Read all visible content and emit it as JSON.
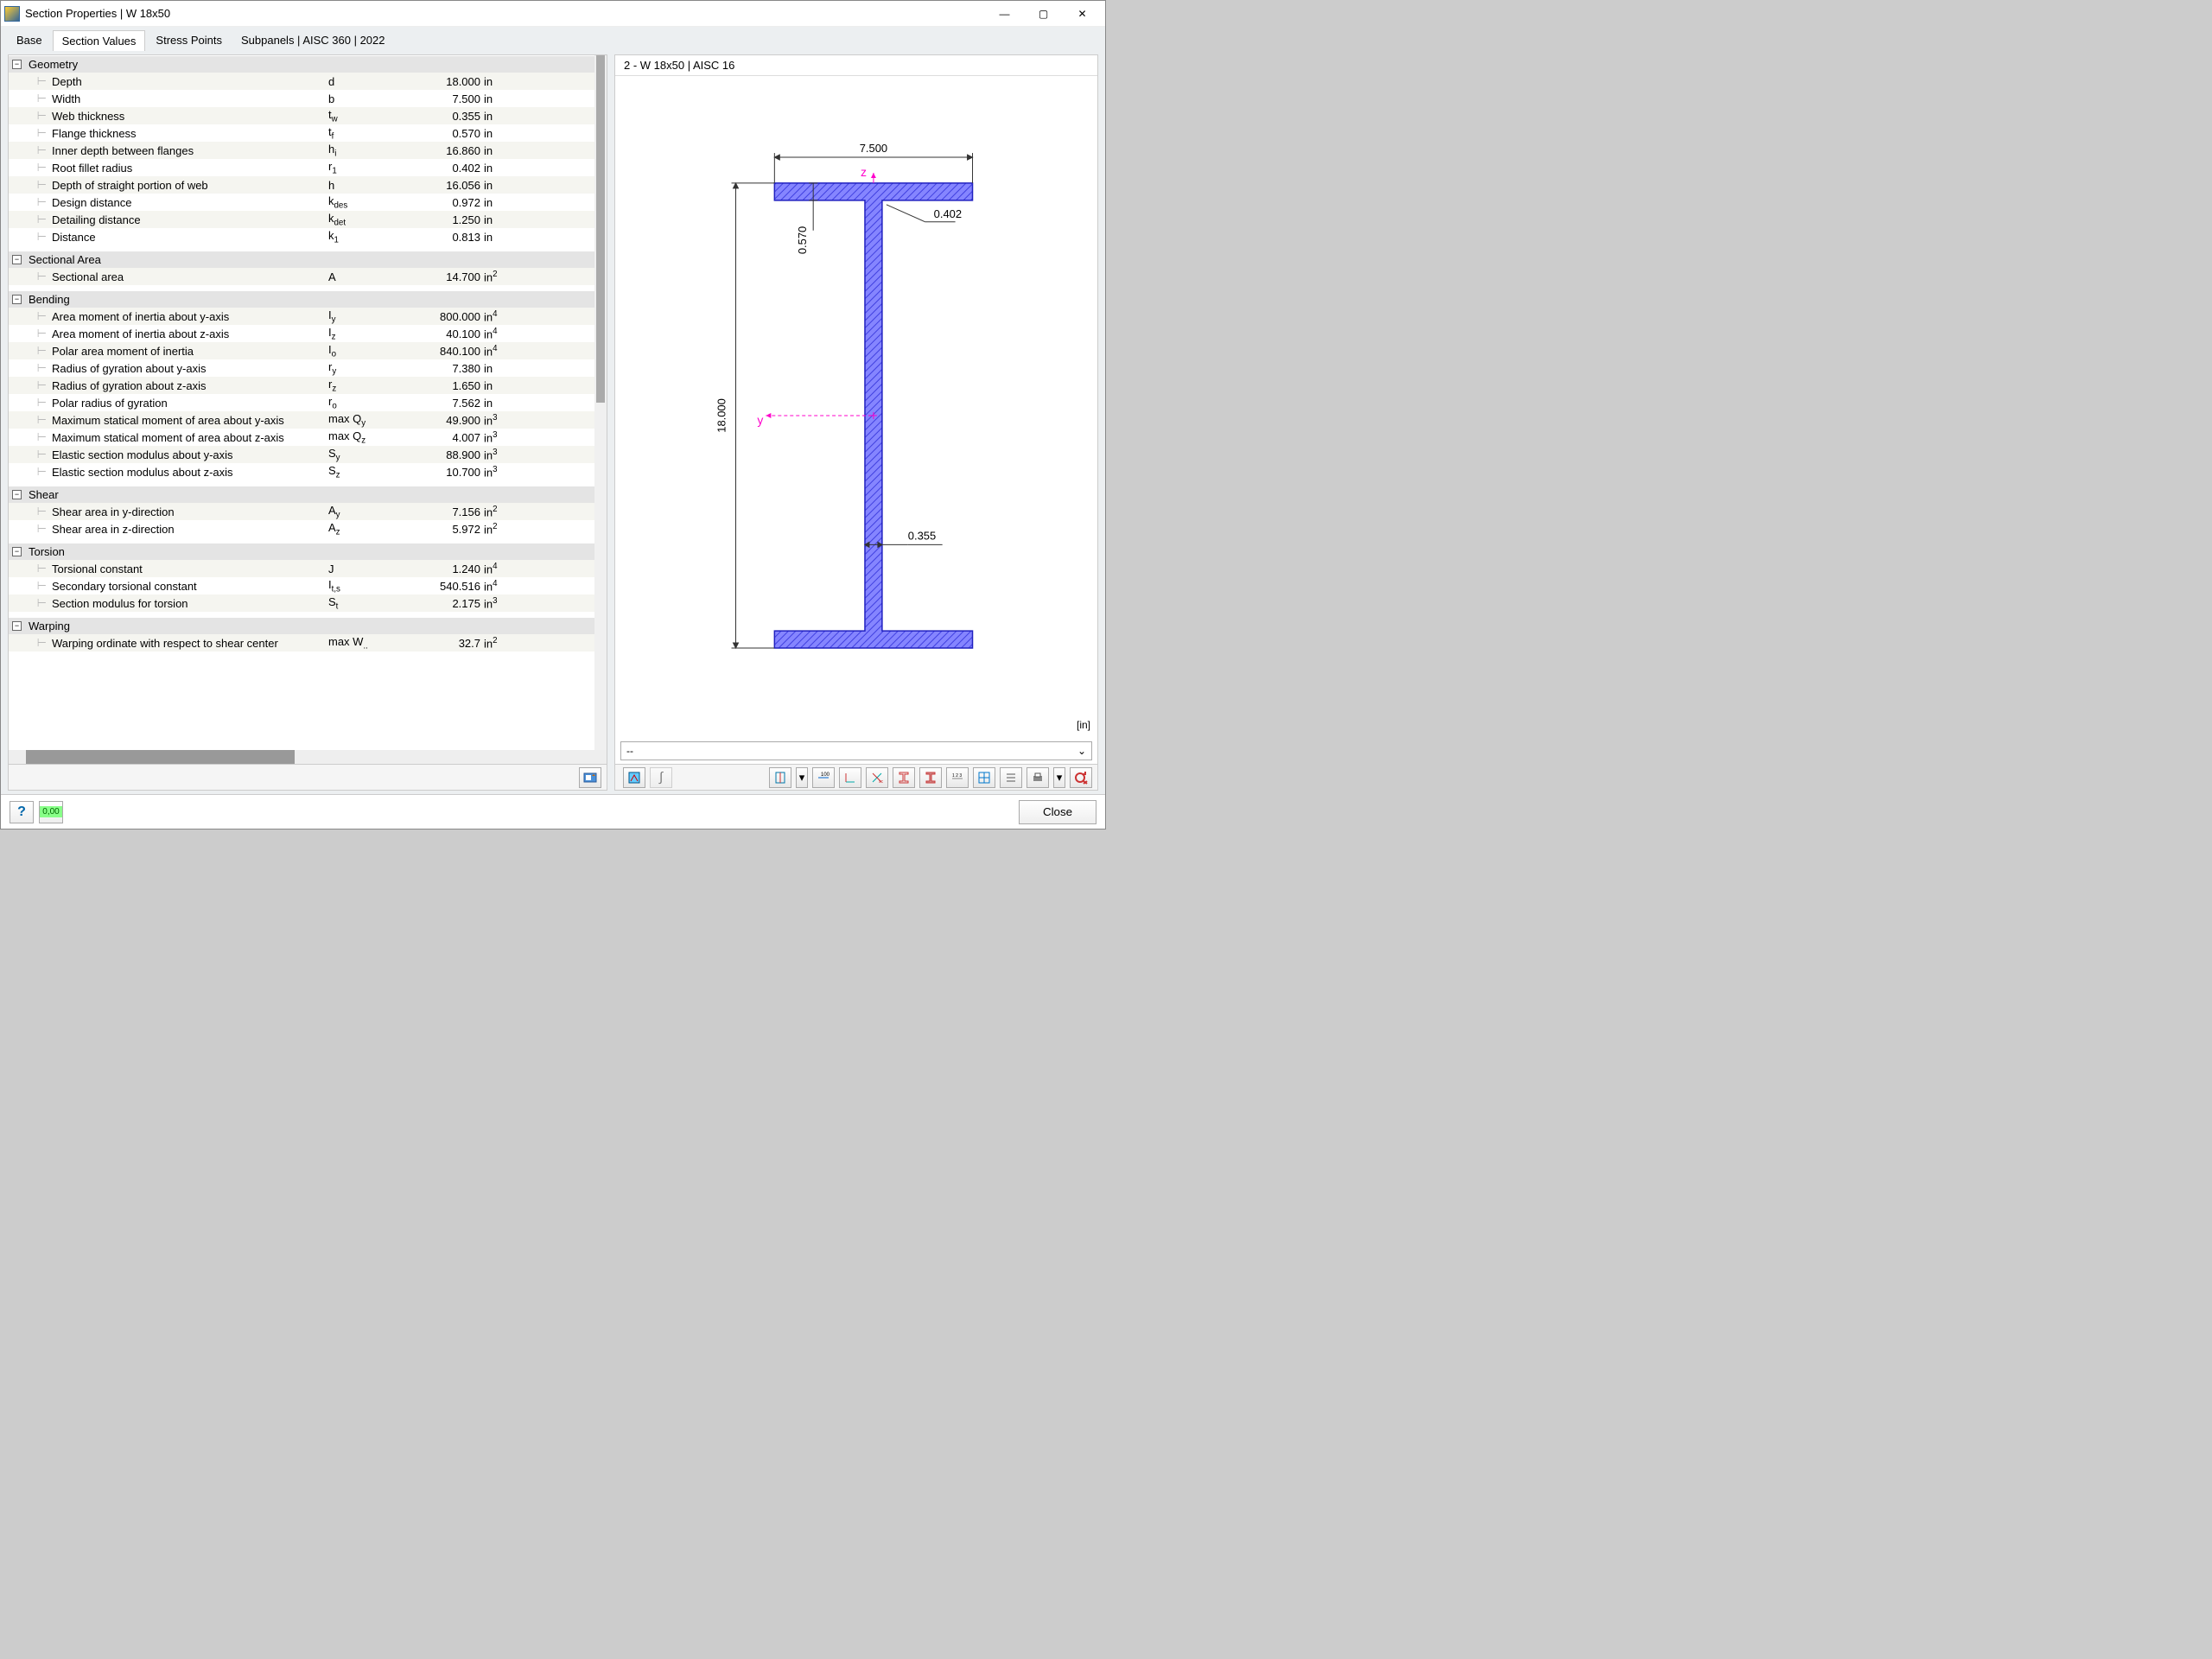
{
  "window_title": "Section Properties | W 18x50",
  "tabs": [
    "Base",
    "Section Values",
    "Stress Points",
    "Subpanels | AISC 360 | 2022"
  ],
  "active_tab": 1,
  "preview_title": "2 - W 18x50 | AISC 16",
  "preview_unit": "[in]",
  "dropdown_value": "--",
  "close_label": "Close",
  "sections": [
    {
      "title": "Geometry",
      "rows": [
        {
          "name": "Depth",
          "sym": "d",
          "val": "18.000",
          "unit": "in"
        },
        {
          "name": "Width",
          "sym": "b",
          "val": "7.500",
          "unit": "in"
        },
        {
          "name": "Web thickness",
          "sym": "t<sub>w</sub>",
          "val": "0.355",
          "unit": "in"
        },
        {
          "name": "Flange thickness",
          "sym": "t<sub>f</sub>",
          "val": "0.570",
          "unit": "in"
        },
        {
          "name": "Inner depth between flanges",
          "sym": "h<sub>i</sub>",
          "val": "16.860",
          "unit": "in"
        },
        {
          "name": "Root fillet radius",
          "sym": "r<sub>1</sub>",
          "val": "0.402",
          "unit": "in"
        },
        {
          "name": "Depth of straight portion of web",
          "sym": "h",
          "val": "16.056",
          "unit": "in"
        },
        {
          "name": "Design distance",
          "sym": "k<sub>des</sub>",
          "val": "0.972",
          "unit": "in"
        },
        {
          "name": "Detailing distance",
          "sym": "k<sub>det</sub>",
          "val": "1.250",
          "unit": "in"
        },
        {
          "name": "Distance",
          "sym": "k<sub>1</sub>",
          "val": "0.813",
          "unit": "in"
        }
      ]
    },
    {
      "title": "Sectional Area",
      "rows": [
        {
          "name": "Sectional area",
          "sym": "A",
          "val": "14.700",
          "unit": "in<sup>2</sup>"
        }
      ]
    },
    {
      "title": "Bending",
      "rows": [
        {
          "name": "Area moment of inertia about y-axis",
          "sym": "I<sub>y</sub>",
          "val": "800.000",
          "unit": "in<sup>4</sup>"
        },
        {
          "name": "Area moment of inertia about z-axis",
          "sym": "I<sub>z</sub>",
          "val": "40.100",
          "unit": "in<sup>4</sup>"
        },
        {
          "name": "Polar area moment of inertia",
          "sym": "I<sub>o</sub>",
          "val": "840.100",
          "unit": "in<sup>4</sup>"
        },
        {
          "name": "Radius of gyration about y-axis",
          "sym": "r<sub>y</sub>",
          "val": "7.380",
          "unit": "in"
        },
        {
          "name": "Radius of gyration about z-axis",
          "sym": "r<sub>z</sub>",
          "val": "1.650",
          "unit": "in"
        },
        {
          "name": "Polar radius of gyration",
          "sym": "r<sub>o</sub>",
          "val": "7.562",
          "unit": "in"
        },
        {
          "name": "Maximum statical moment of area about y-axis",
          "sym": "max Q<sub>y</sub>",
          "val": "49.900",
          "unit": "in<sup>3</sup>"
        },
        {
          "name": "Maximum statical moment of area about z-axis",
          "sym": "max Q<sub>z</sub>",
          "val": "4.007",
          "unit": "in<sup>3</sup>"
        },
        {
          "name": "Elastic section modulus about y-axis",
          "sym": "S<sub>y</sub>",
          "val": "88.900",
          "unit": "in<sup>3</sup>"
        },
        {
          "name": "Elastic section modulus about z-axis",
          "sym": "S<sub>z</sub>",
          "val": "10.700",
          "unit": "in<sup>3</sup>"
        }
      ]
    },
    {
      "title": "Shear",
      "rows": [
        {
          "name": "Shear area in y-direction",
          "sym": "A<sub>y</sub>",
          "val": "7.156",
          "unit": "in<sup>2</sup>"
        },
        {
          "name": "Shear area in z-direction",
          "sym": "A<sub>z</sub>",
          "val": "5.972",
          "unit": "in<sup>2</sup>"
        }
      ]
    },
    {
      "title": "Torsion",
      "rows": [
        {
          "name": "Torsional constant",
          "sym": "J",
          "val": "1.240",
          "unit": "in<sup>4</sup>"
        },
        {
          "name": "Secondary torsional constant",
          "sym": "I<sub>t,s</sub>",
          "val": "540.516",
          "unit": "in<sup>4</sup>"
        },
        {
          "name": "Section modulus for torsion",
          "sym": "S<sub>t</sub>",
          "val": "2.175",
          "unit": "in<sup>3</sup>"
        }
      ]
    },
    {
      "title": "Warping",
      "rows": [
        {
          "name": "Warping ordinate with respect to shear center",
          "sym": "max W<sub>..</sub>",
          "val": "32.7",
          "unit": "in<sup>2</sup>"
        }
      ]
    }
  ],
  "beam_dims": {
    "depth": "18.000",
    "width": "7.500",
    "tf": "0.570",
    "tw": "0.355",
    "r": "0.402"
  },
  "axes": {
    "y": "y",
    "z": "z"
  }
}
